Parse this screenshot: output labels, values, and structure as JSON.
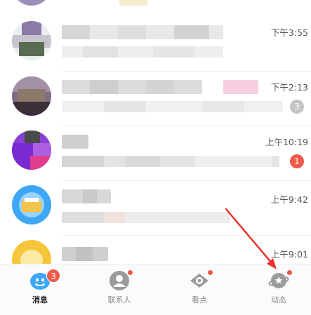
{
  "chats": [
    {
      "time": "",
      "badge": ""
    },
    {
      "time": "下午3:55",
      "badge": ""
    },
    {
      "time": "下午2:13",
      "badge": "3"
    },
    {
      "time": "上午10:19",
      "badge": "1"
    },
    {
      "time": "上午9:42",
      "badge": ""
    },
    {
      "time": "上午9:01",
      "badge": ""
    }
  ],
  "tabs": [
    {
      "label": "消息",
      "icon": "penguin-message-icon",
      "count": "3"
    },
    {
      "label": "联系人",
      "icon": "contacts-icon",
      "count": ""
    },
    {
      "label": "看点",
      "icon": "eye-icon",
      "count": ""
    },
    {
      "label": "动态",
      "icon": "planet-icon",
      "count": ""
    }
  ],
  "colors": {
    "accent": "#3ea7f5",
    "badge_red": "#f0584a",
    "badge_grey": "#c4c4c4",
    "arrow": "#e8322c"
  }
}
